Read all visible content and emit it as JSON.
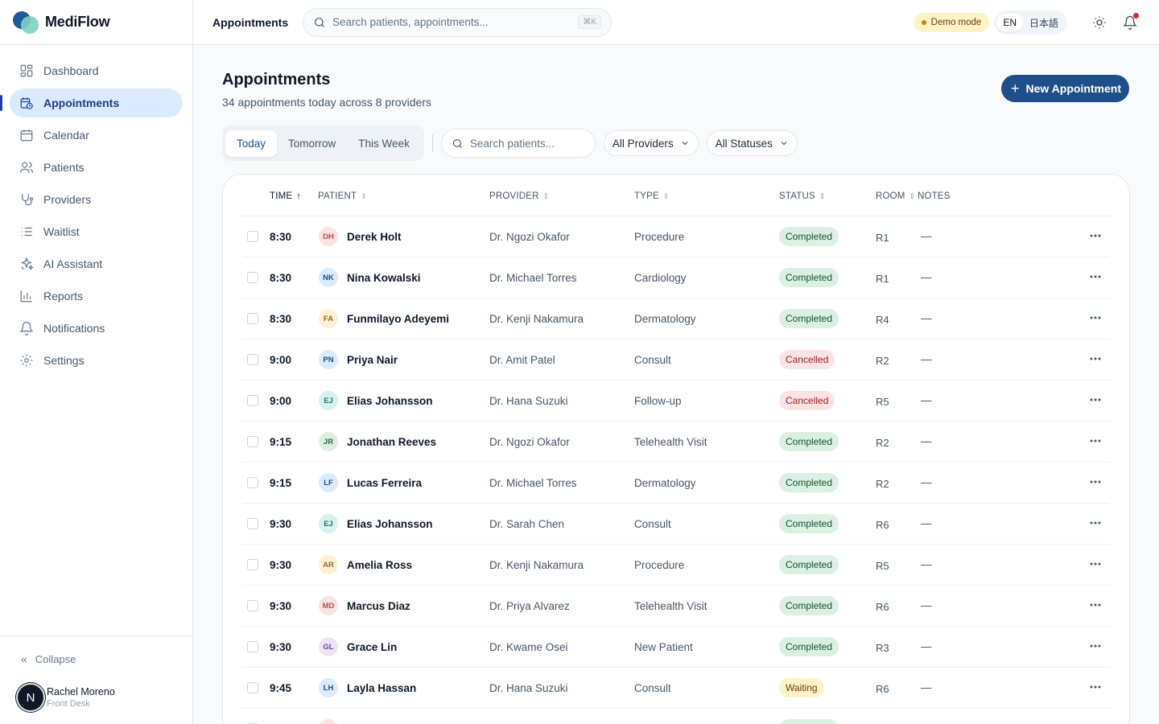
{
  "app": {
    "name": "MediFlow"
  },
  "sidebar": {
    "items": [
      {
        "label": "Dashboard",
        "icon": "dashboard-icon"
      },
      {
        "label": "Appointments",
        "icon": "calendar-clock-icon",
        "active": true
      },
      {
        "label": "Calendar",
        "icon": "calendar-icon"
      },
      {
        "label": "Patients",
        "icon": "users-icon"
      },
      {
        "label": "Providers",
        "icon": "stethoscope-icon"
      },
      {
        "label": "Waitlist",
        "icon": "list-icon"
      },
      {
        "label": "AI Assistant",
        "icon": "sparkles-icon"
      },
      {
        "label": "Reports",
        "icon": "bar-chart-icon"
      },
      {
        "label": "Notifications",
        "icon": "bell-icon"
      },
      {
        "label": "Settings",
        "icon": "gear-icon"
      }
    ],
    "collapse_label": "Collapse",
    "user": {
      "initial": "N",
      "name": "Rachel Moreno",
      "role": "Front Desk"
    }
  },
  "topbar": {
    "title": "Appointments",
    "search_placeholder": "Search patients, appointments...",
    "shortcut": "⌘K",
    "demo_label": "Demo mode",
    "lang_en": "EN",
    "lang_ja": "日本語"
  },
  "page": {
    "title": "Appointments",
    "subtitle": "34 appointments today across 8 providers",
    "new_button": "New Appointment"
  },
  "filters": {
    "tabs": [
      "Today",
      "Tomorrow",
      "This Week"
    ],
    "active_tab": "Today",
    "search_placeholder": "Search patients...",
    "provider_select": "All Providers",
    "status_select": "All Statuses"
  },
  "table": {
    "columns": {
      "time": "Time",
      "patient": "Patient",
      "provider": "Provider",
      "type": "Type",
      "status": "Status",
      "room": "Room",
      "notes": "Notes"
    },
    "rows": [
      {
        "time": "8:30",
        "initials": "DH",
        "patient": "Derek Holt",
        "provider": "Dr. Ngozi Okafor",
        "type": "Procedure",
        "status": "Completed",
        "room": "R1",
        "notes": "—",
        "avatar_bg": "#fde2e2",
        "avatar_fg": "#b45353"
      },
      {
        "time": "8:30",
        "initials": "NK",
        "patient": "Nina Kowalski",
        "provider": "Dr. Michael Torres",
        "type": "Cardiology",
        "status": "Completed",
        "room": "R1",
        "notes": "—",
        "avatar_bg": "#dbeafe",
        "avatar_fg": "#1e4f8a"
      },
      {
        "time": "8:30",
        "initials": "FA",
        "patient": "Funmilayo Adeyemi",
        "provider": "Dr. Kenji Nakamura",
        "type": "Dermatology",
        "status": "Completed",
        "room": "R4",
        "notes": "—",
        "avatar_bg": "#fdf0d5",
        "avatar_fg": "#9a6b14"
      },
      {
        "time": "9:00",
        "initials": "PN",
        "patient": "Priya Nair",
        "provider": "Dr. Amit Patel",
        "type": "Consult",
        "status": "Cancelled",
        "room": "R2",
        "notes": "—",
        "avatar_bg": "#dbeafe",
        "avatar_fg": "#1e4f8a"
      },
      {
        "time": "9:00",
        "initials": "EJ",
        "patient": "Elias Johansson",
        "provider": "Dr. Hana Suzuki",
        "type": "Follow-up",
        "status": "Cancelled",
        "room": "R5",
        "notes": "—",
        "avatar_bg": "#d5f2ee",
        "avatar_fg": "#1f7a6e"
      },
      {
        "time": "9:15",
        "initials": "JR",
        "patient": "Jonathan Reeves",
        "provider": "Dr. Ngozi Okafor",
        "type": "Telehealth Visit",
        "status": "Completed",
        "room": "R2",
        "notes": "—",
        "avatar_bg": "#dcefe3",
        "avatar_fg": "#2f6b45"
      },
      {
        "time": "9:15",
        "initials": "LF",
        "patient": "Lucas Ferreira",
        "provider": "Dr. Michael Torres",
        "type": "Dermatology",
        "status": "Completed",
        "room": "R2",
        "notes": "—",
        "avatar_bg": "#dbeafe",
        "avatar_fg": "#1e4f8a"
      },
      {
        "time": "9:30",
        "initials": "EJ",
        "patient": "Elias Johansson",
        "provider": "Dr. Sarah Chen",
        "type": "Consult",
        "status": "Completed",
        "room": "R6",
        "notes": "—",
        "avatar_bg": "#d5f2ee",
        "avatar_fg": "#1f7a6e"
      },
      {
        "time": "9:30",
        "initials": "AR",
        "patient": "Amelia Ross",
        "provider": "Dr. Kenji Nakamura",
        "type": "Procedure",
        "status": "Completed",
        "room": "R5",
        "notes": "—",
        "avatar_bg": "#fdf0d5",
        "avatar_fg": "#9a6b14"
      },
      {
        "time": "9:30",
        "initials": "MD",
        "patient": "Marcus Diaz",
        "provider": "Dr. Priya Alvarez",
        "type": "Telehealth Visit",
        "status": "Completed",
        "room": "R6",
        "notes": "—",
        "avatar_bg": "#fde2e2",
        "avatar_fg": "#b45353"
      },
      {
        "time": "9:30",
        "initials": "GL",
        "patient": "Grace Lin",
        "provider": "Dr. Kwame Osei",
        "type": "New Patient",
        "status": "Completed",
        "room": "R3",
        "notes": "—",
        "avatar_bg": "#ede4f7",
        "avatar_fg": "#6b4a94"
      },
      {
        "time": "9:45",
        "initials": "LH",
        "patient": "Layla Hassan",
        "provider": "Dr. Hana Suzuki",
        "type": "Consult",
        "status": "Waiting",
        "room": "R6",
        "notes": "—",
        "avatar_bg": "#dbeafe",
        "avatar_fg": "#1e4f8a"
      },
      {
        "time": "",
        "initials": "",
        "patient": "",
        "provider": "",
        "type": "",
        "status": "Completed",
        "room": "",
        "notes": "",
        "avatar_bg": "#fde2e2",
        "avatar_fg": "#b45353"
      }
    ]
  },
  "colors": {
    "brand": "#1e4f8a",
    "accent": "#7dd3c0",
    "active_bg": "#dbeafe"
  }
}
